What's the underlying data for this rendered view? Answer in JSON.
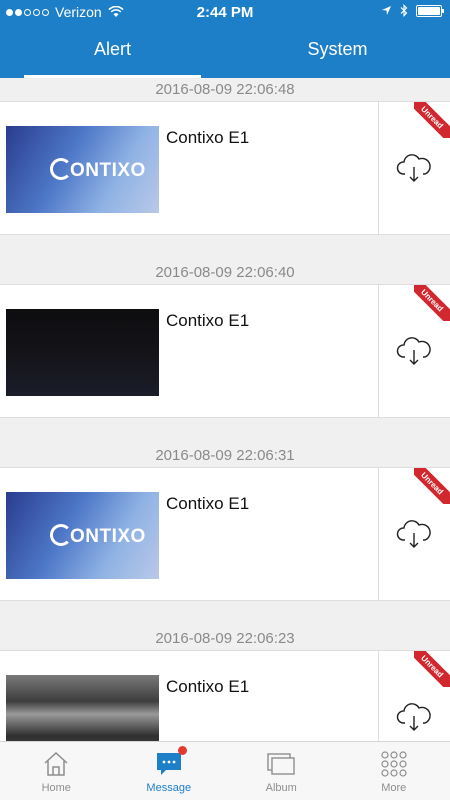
{
  "status": {
    "carrier": "Verizon",
    "time": "2:44 PM"
  },
  "tabs": [
    {
      "label": "Alert",
      "active": true
    },
    {
      "label": "System",
      "active": false
    }
  ],
  "alerts": [
    {
      "timestamp": "2016-08-09 22:06:48",
      "device": "Contixo E1",
      "badge": "Unread",
      "thumbnail": "contixo-logo-blue"
    },
    {
      "timestamp": "2016-08-09 22:06:40",
      "device": "Contixo E1",
      "badge": "Unread",
      "thumbnail": "dark-frame"
    },
    {
      "timestamp": "2016-08-09 22:06:31",
      "device": "Contixo E1",
      "badge": "Unread",
      "thumbnail": "contixo-logo-blue"
    },
    {
      "timestamp": "2016-08-09 22:06:23",
      "device": "Contixo E1",
      "badge": "Unread",
      "thumbnail": "room-grayscale"
    }
  ],
  "thumbnail_logo": "ONTIXO",
  "bottom_nav": [
    {
      "label": "Home",
      "icon": "home-icon"
    },
    {
      "label": "Message",
      "icon": "message-icon",
      "active": true
    },
    {
      "label": "Album",
      "icon": "album-icon"
    },
    {
      "label": "More",
      "icon": "more-grid-icon"
    }
  ],
  "colors": {
    "primary": "#1e7fc9",
    "unread_ribbon": "#d0282e",
    "badge": "#e23a2e"
  }
}
